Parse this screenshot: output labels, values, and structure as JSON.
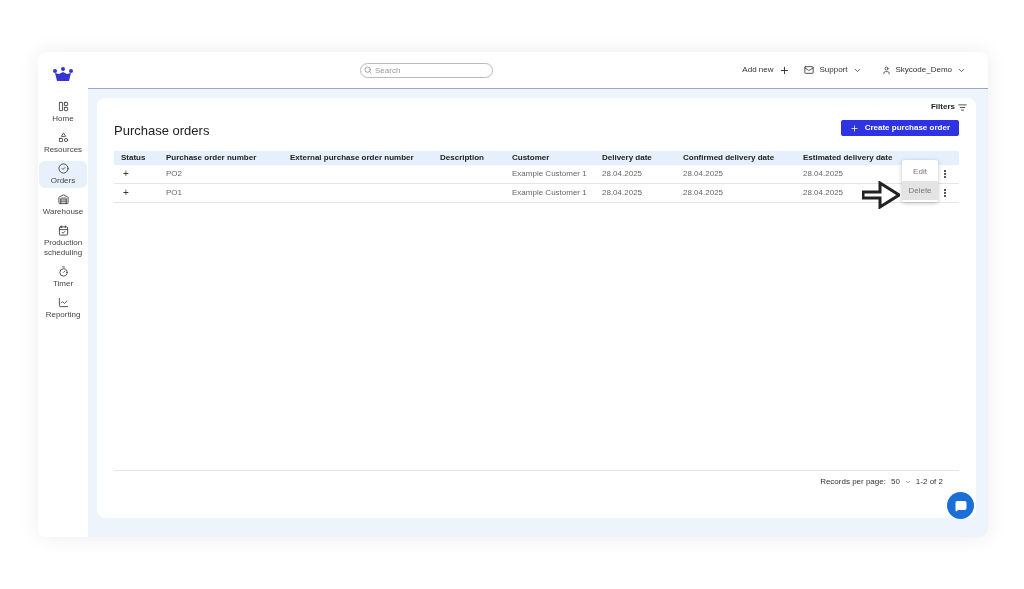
{
  "topbar": {
    "search": {
      "placeholder": "Search"
    },
    "add_new": "Add new",
    "support": "Support",
    "user": "Skycode_Demo"
  },
  "sidebar": {
    "items": [
      {
        "label": "Home",
        "selected": false
      },
      {
        "label": "Resources",
        "selected": false
      },
      {
        "label": "Orders",
        "selected": true
      },
      {
        "label": "Warehouse",
        "selected": false
      },
      {
        "label": "Production scheduling",
        "selected": false
      },
      {
        "label": "Timer",
        "selected": false
      },
      {
        "label": "Reporting",
        "selected": false
      }
    ]
  },
  "page": {
    "title": "Purchase orders",
    "filters": "Filters",
    "create_button": "Create purchase order"
  },
  "table": {
    "columns": [
      "Status",
      "Purchase order number",
      "External purchase order number",
      "Description",
      "Customer",
      "Delivery date",
      "Confirmed delivery date",
      "Estimated delivery date"
    ],
    "rows": [
      {
        "status": "+",
        "number": "PO2",
        "customer": "Example Customer 1",
        "delivery": "28.04.2025",
        "confirmed": "28.04.2025",
        "estimated": "28.04.2025"
      },
      {
        "status": "+",
        "number": "PO1",
        "customer": "Example Customer 1",
        "delivery": "28.04.2025",
        "confirmed": "28.04.2025",
        "estimated": "28.04.2025"
      }
    ]
  },
  "row_menu": {
    "items": [
      {
        "label": "Edit",
        "selected": false
      },
      {
        "label": "Delete",
        "selected": true
      }
    ]
  },
  "pagination": {
    "label": "Records per page:",
    "per_page": "50",
    "range": "1-2 of 2"
  }
}
